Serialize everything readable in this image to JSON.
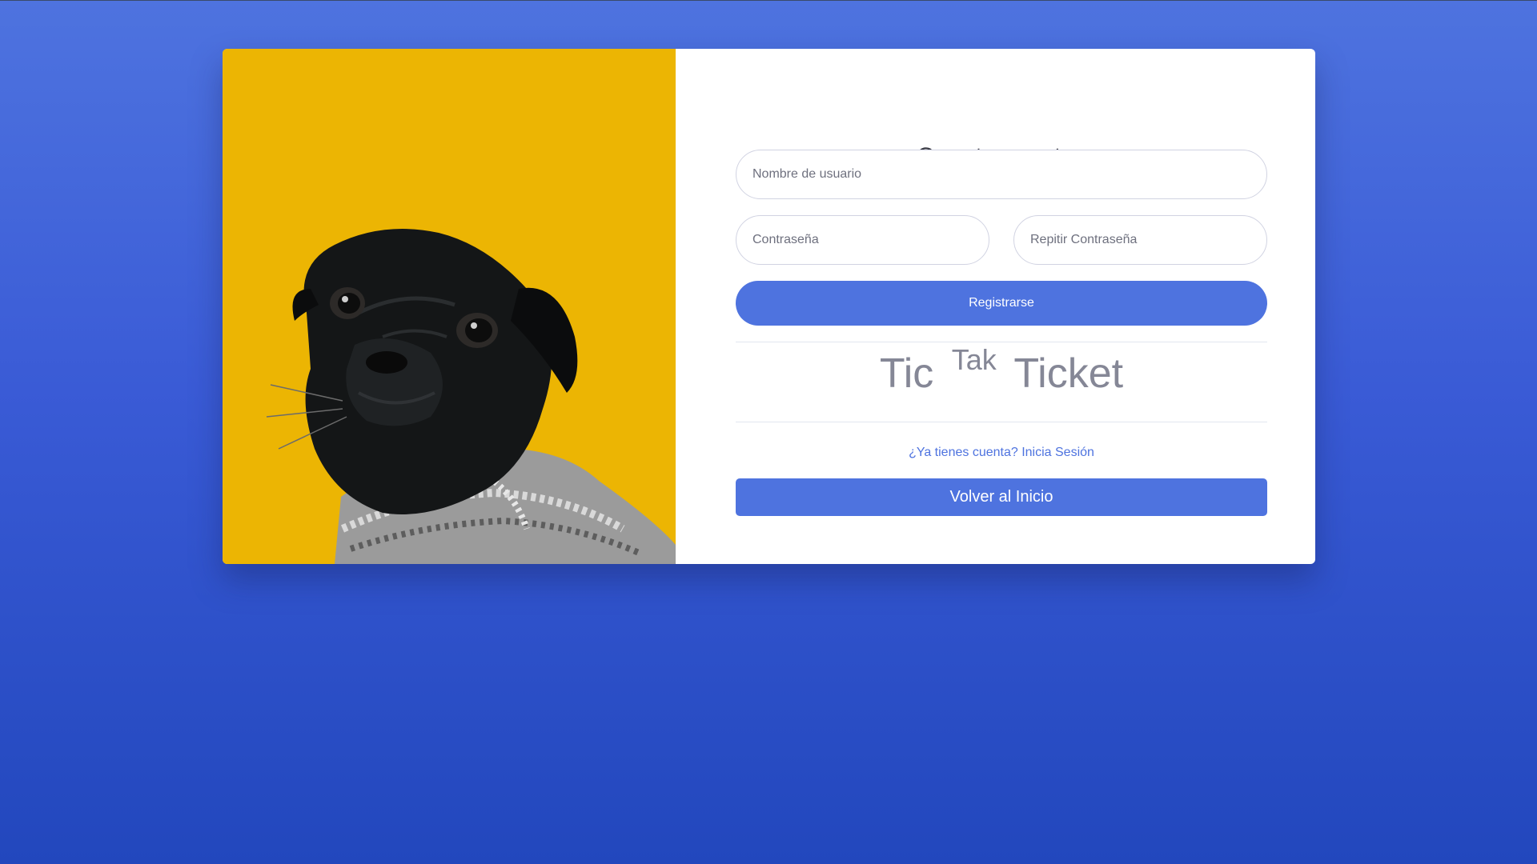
{
  "page": {
    "title": "Crea tu cuenta"
  },
  "form": {
    "username_placeholder": "Nombre de usuario",
    "password_placeholder": "Contraseña",
    "repeat_password_placeholder": "Repitir Contraseña",
    "register_label": "Registrarse"
  },
  "brand": {
    "part1": "Tic",
    "part2": "Tak",
    "part3": "Ticket"
  },
  "links": {
    "login": "¿Ya tienes cuenta? Inicia Sesión",
    "home": "Volver al Inicio"
  },
  "image": {
    "subject": "pug wearing knit sweater on yellow background"
  },
  "colors": {
    "primary": "#4e73df",
    "image_background": "#ecb503",
    "text_muted": "#858796"
  }
}
